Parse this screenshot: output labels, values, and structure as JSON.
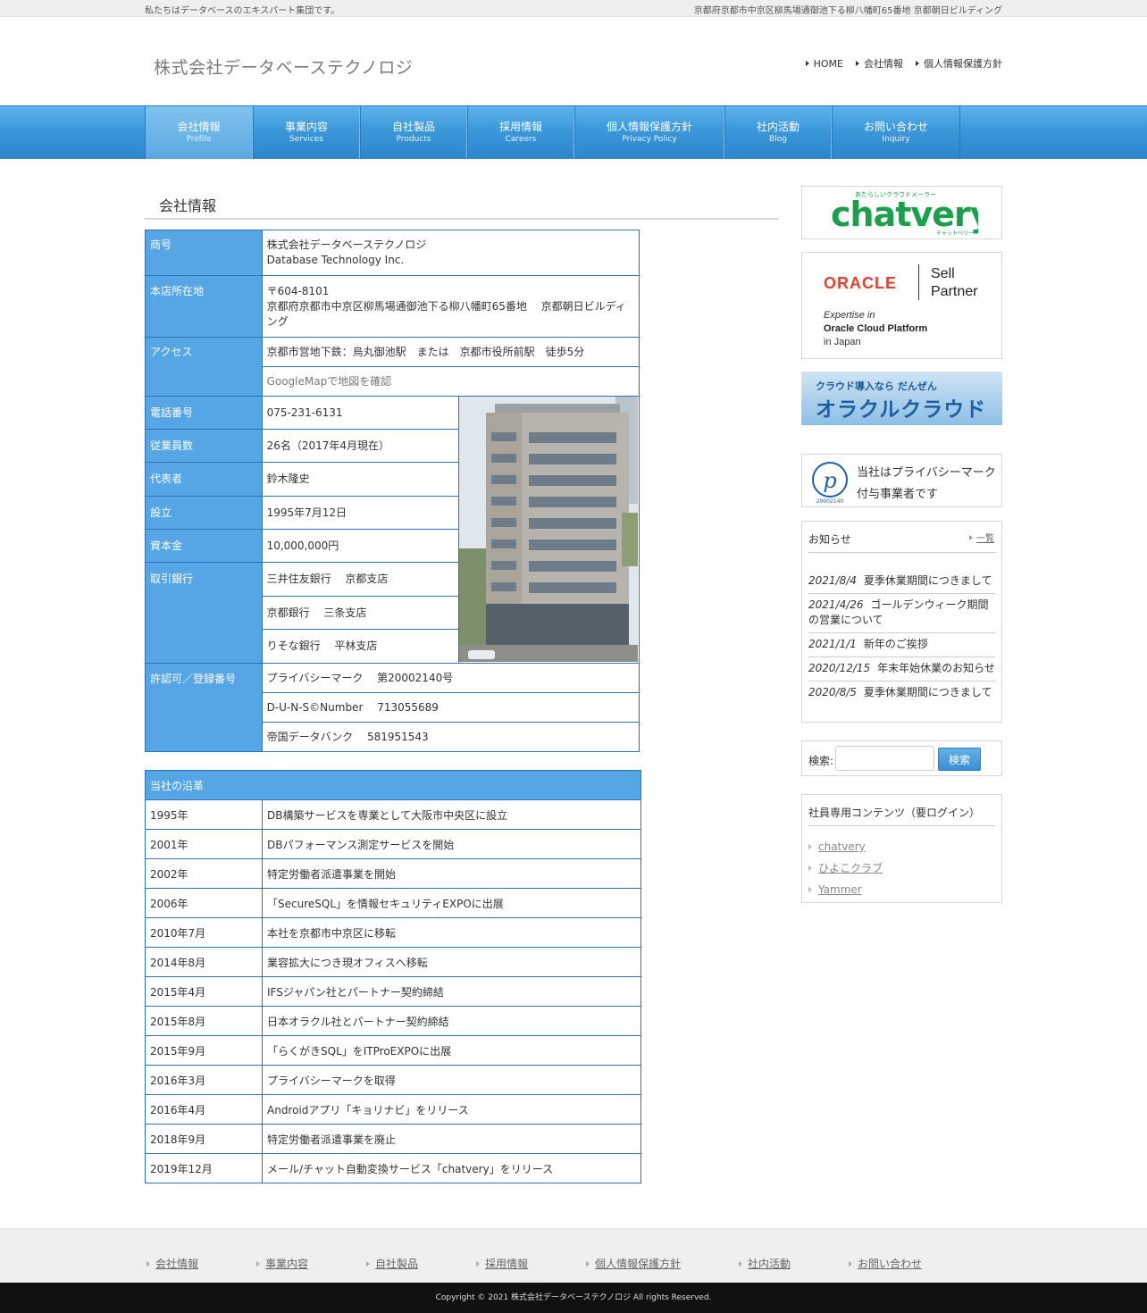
{
  "topbar": {
    "tagline": "私たちはデータベースのエキスパート集団です。",
    "address": "京都府京都市中京区柳馬場通御池下る柳八幡町65番地 京都朝日ビルディング"
  },
  "header": {
    "logo": "株式会社データベーステクノロジ",
    "nav": [
      "HOME",
      "会社情報",
      "個人情報保護方針"
    ]
  },
  "global_nav": [
    {
      "ja": "会社情報",
      "en": "Profile"
    },
    {
      "ja": "事業内容",
      "en": "Services"
    },
    {
      "ja": "自社製品",
      "en": "Products"
    },
    {
      "ja": "採用情報",
      "en": "Careers"
    },
    {
      "ja": "個人情報保護方針",
      "en": "Privacy Policy"
    },
    {
      "ja": "社内活動",
      "en": "Blog"
    },
    {
      "ja": "お問い合わせ",
      "en": "Inquiry"
    }
  ],
  "page_title": "会社情報",
  "info": {
    "name_label": "商号",
    "name_ja": "株式会社データベーステクノロジ",
    "name_en": "Database Technology Inc.",
    "address_label": "本店所在地",
    "postal": "〒604-8101",
    "address": "京都府京都市中京区柳馬場通御池下る柳八幡町65番地　 京都朝日ビルディング",
    "access_label": "アクセス",
    "access": "京都市営地下鉄：烏丸御池駅　または　京都市役所前駅　徒歩5分",
    "map_link": "GoogleMapで地図を確認",
    "phone_label": "電話番号",
    "phone": "075-231-6131",
    "employees_label": "従業員数",
    "employees": "26名（2017年4月現在）",
    "rep_label": "代表者",
    "rep": "鈴木隆史",
    "founded_label": "設立",
    "founded": "1995年7月12日",
    "capital_label": "資本金",
    "capital": "10,000,000円",
    "bank_label": "取引銀行",
    "banks": [
      "三井住友銀行　 京都支店",
      "京都銀行　 三条支店",
      "りそな銀行　 平林支店"
    ],
    "license_label": "許認可／登録番号",
    "licenses": [
      "プライバシーマーク　 第20002140号",
      "D-U-N-S©Number　 713055689",
      "帝国データバンク　 581951543"
    ]
  },
  "history": {
    "title": "当社の沿革",
    "rows": [
      {
        "year": "1995年",
        "event": "DB構築サービスを専業として大阪市中央区に設立"
      },
      {
        "year": "2001年",
        "event": "DBパフォーマンス測定サービスを開始"
      },
      {
        "year": "2002年",
        "event": "特定労働者派遣事業を開始"
      },
      {
        "year": "2006年",
        "event": "「SecureSQL」を情報セキュリティEXPOに出展"
      },
      {
        "year": "2010年7月",
        "event": "本社を京都市中京区に移転"
      },
      {
        "year": "2014年8月",
        "event": "業容拡大につき現オフィスへ移転"
      },
      {
        "year": "2015年4月",
        "event": "IFSジャパン社とパートナー契約締結"
      },
      {
        "year": "2015年8月",
        "event": "日本オラクル社とパートナー契約締結"
      },
      {
        "year": "2015年9月",
        "event": "「らくがきSQL」をITProEXPOに出展"
      },
      {
        "year": "2016年3月",
        "event": "プライバシーマークを取得"
      },
      {
        "year": "2016年4月",
        "event": "Androidアプリ「キョリナビ」をリリース"
      },
      {
        "year": "2018年9月",
        "event": "特定労働者派遣事業を廃止"
      },
      {
        "year": "2019年12月",
        "event": "メール/チャット自動変換サービス「chatvery」をリリース"
      }
    ]
  },
  "sidebar": {
    "chatvery_small": "あたらしいクラウドメーラー",
    "chatvery_logo": "chatvery",
    "chatvery_kana": "チャットベリー",
    "oracle_logo": "ORACLE",
    "oracle_sell": "Sell",
    "oracle_partner": "Partner",
    "oracle_expertise": "Expertise in",
    "oracle_platform": "Oracle Cloud Platform",
    "oracle_japan": "in Japan",
    "cloud_line1": "クラウド導入なら だんぜん",
    "cloud_line2": "オラクルクラウド",
    "pmark_number": "20002140",
    "pmark_text1": "当社はプライバシーマーク",
    "pmark_text2": "付与事業者です",
    "news_title": "お知らせ",
    "news_more": "一覧",
    "news": [
      {
        "date": "2021/8/4",
        "text": "夏季休業期間につきまして"
      },
      {
        "date": "2021/4/26",
        "text": "ゴールデンウィーク期間の営業について"
      },
      {
        "date": "2021/1/1",
        "text": "新年のご挨拶"
      },
      {
        "date": "2020/12/15",
        "text": "年末年始休業のお知らせ"
      },
      {
        "date": "2020/8/5",
        "text": "夏季休業期間につきまして"
      }
    ],
    "search_label": "検索:",
    "search_value": "",
    "search_button": "検索",
    "member_title": "社員専用コンテンツ（要ログイン）",
    "member_links": [
      "chatvery",
      "ひよこクラブ",
      "Yammer"
    ]
  },
  "footer": {
    "nav": [
      "会社情報",
      "事業内容",
      "自社製品",
      "採用情報",
      "個人情報保護方針",
      "社内活動",
      "お問い合わせ"
    ],
    "copyright": "Copyright © 2021 株式会社データベーステクノロジ All rights Reserved."
  },
  "colors": {
    "nav_blue": "#3c98d9",
    "table_header": "#56a6e6",
    "table_border": "#2c73b1",
    "chatvery_green": "#1a9f4a",
    "oracle_red": "#e2412e"
  }
}
